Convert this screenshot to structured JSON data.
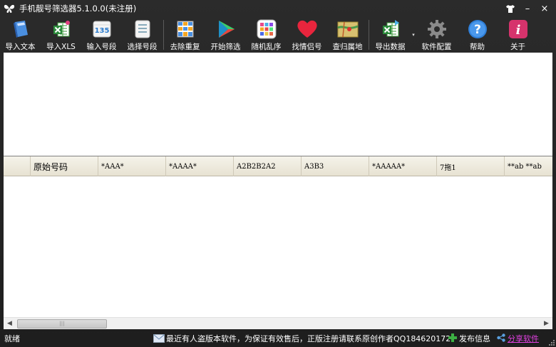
{
  "window": {
    "title": "手机靓号筛选器5.1.0.0(未注册)",
    "controls": {
      "skin": "👕",
      "minimize": "–",
      "close": "×"
    }
  },
  "toolbar": {
    "buttons": [
      {
        "label": "导入文本",
        "icon": "book-icon"
      },
      {
        "label": "导入XLS",
        "icon": "excel-icon"
      },
      {
        "label": "输入号段",
        "icon": "number-prefix-icon",
        "icon_text": "135"
      },
      {
        "label": "选择号段",
        "icon": "list-select-icon"
      },
      {
        "label": "去除重复",
        "icon": "dedupe-grid-icon"
      },
      {
        "label": "开始筛选",
        "icon": "play-icon"
      },
      {
        "label": "随机乱序",
        "icon": "shuffle-tiles-icon"
      },
      {
        "label": "找情侣号",
        "icon": "heart-icon"
      },
      {
        "label": "查归属地",
        "icon": "map-icon"
      },
      {
        "label": "导出数据",
        "icon": "export-excel-icon"
      },
      {
        "label": "软件配置",
        "icon": "gear-icon"
      },
      {
        "label": "帮助",
        "icon": "help-icon",
        "icon_text": "?"
      },
      {
        "label": "关于",
        "icon": "info-icon",
        "icon_text": "i"
      }
    ],
    "export_dropdown": "▾"
  },
  "grid": {
    "columns": [
      "",
      "原始号码",
      "*AAA*",
      "*AAAA*",
      "A2B2B2A2",
      "A3B3",
      "*AAAAA*",
      "7拖1",
      "**ab **ab"
    ]
  },
  "scrollbar": {
    "left": "◀",
    "right": "▶",
    "grip": "|||"
  },
  "status": {
    "state": "就绪",
    "notice": "最近有人盗版本软件，为保证有效售后，正版注册请联系原创作者QQ184620172",
    "publish": "发布信息",
    "share": "分享软件"
  },
  "colors": {
    "accent_heart": "#e8253d",
    "help_blue": "#2f7fd8",
    "info_pink": "#d6336c",
    "share_link": "#e040e0"
  }
}
